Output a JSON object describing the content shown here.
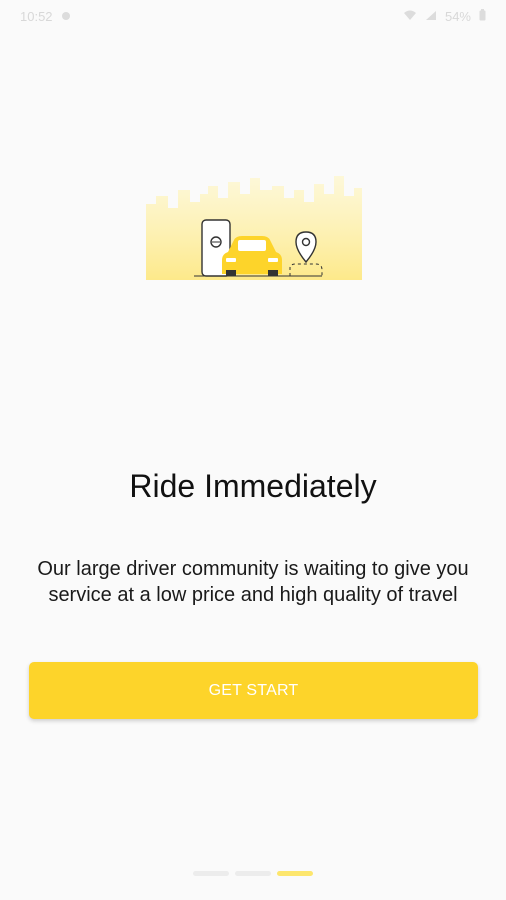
{
  "status_bar": {
    "time": "10:52",
    "battery": "54%"
  },
  "onboarding": {
    "title": "Ride Immediately",
    "description": "Our large driver community is waiting to give you service at a low price and high quality of travel",
    "cta_label": "GET START",
    "pages": 3,
    "active_page": 3
  },
  "colors": {
    "accent": "#fdd42a",
    "indicator_active": "#fde66d",
    "indicator_inactive": "#ececec",
    "background": "#fafafa"
  },
  "icons": {
    "illustration": "taxi-city-illustration",
    "status_left": "notification-icon",
    "status_right": [
      "wifi-icon",
      "signal-icon",
      "battery-icon"
    ]
  }
}
